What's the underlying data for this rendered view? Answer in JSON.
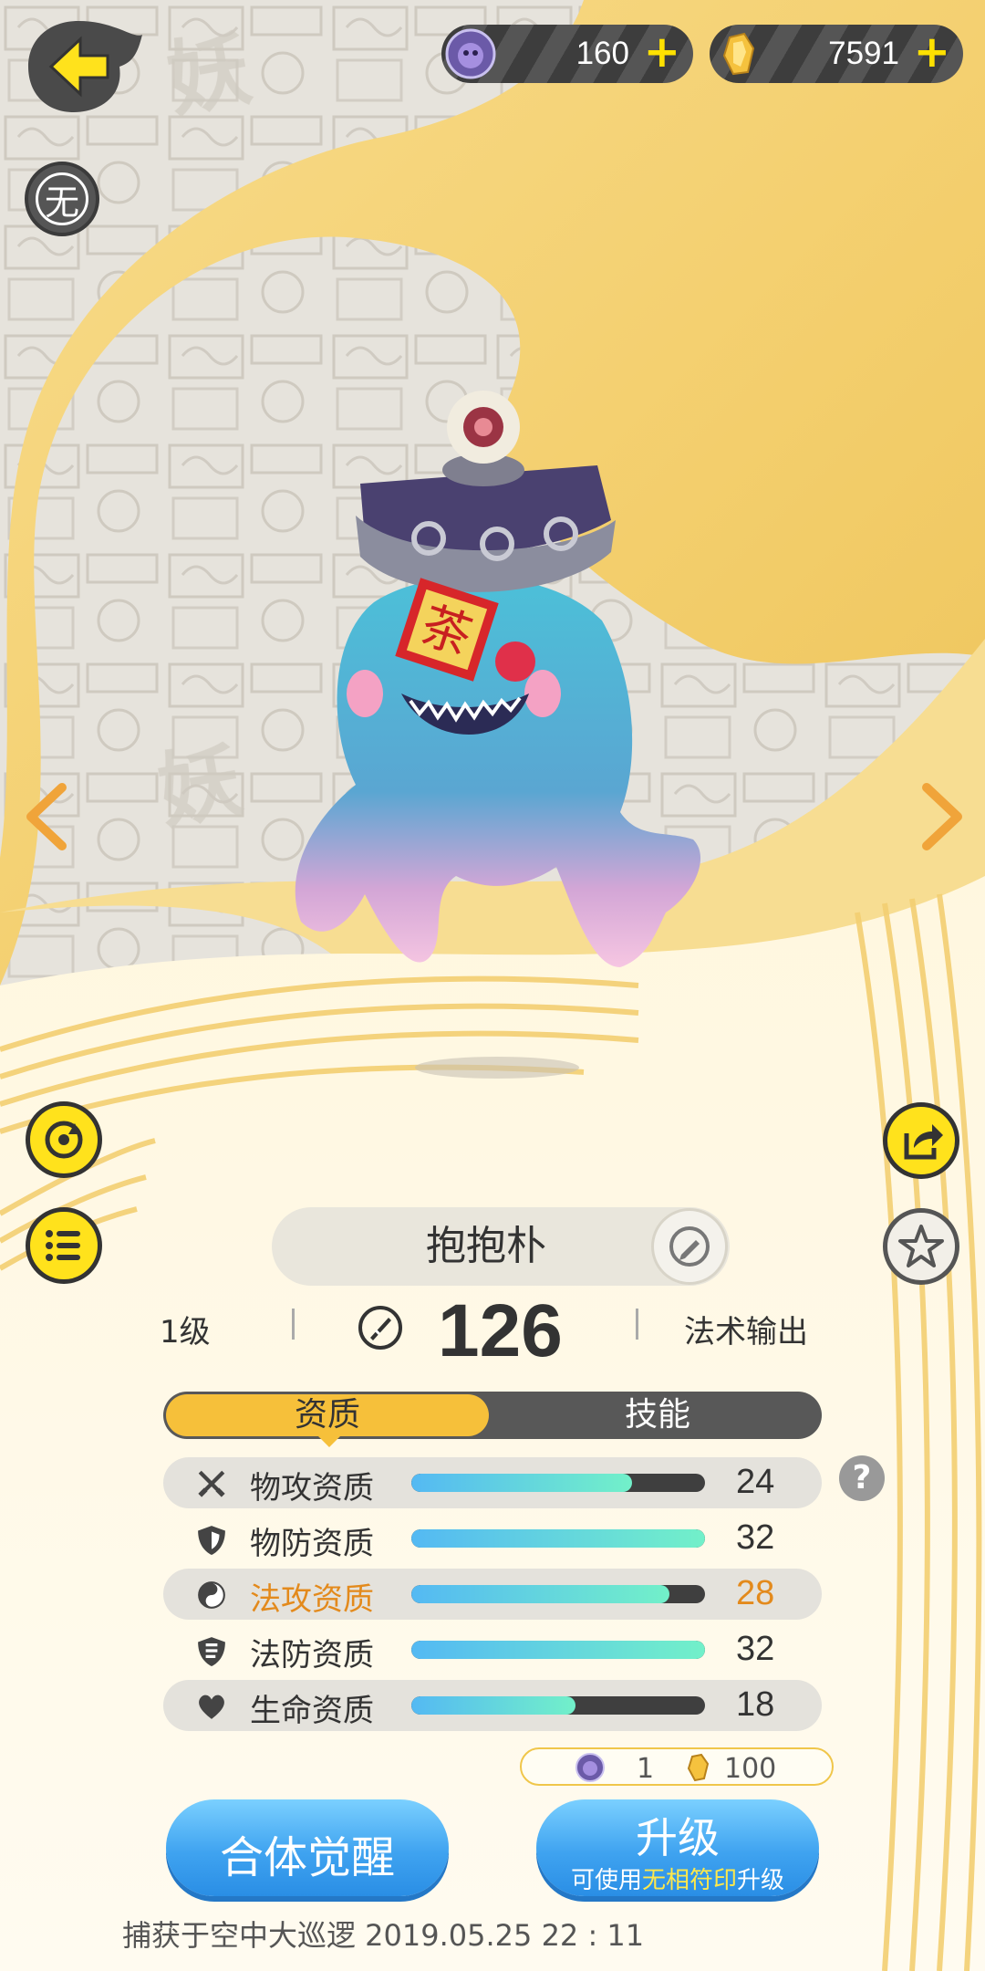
{
  "top_bar": {
    "currency_orb": {
      "value": "160",
      "plus": "+"
    },
    "currency_crystal": {
      "value": "7591",
      "plus": "+"
    }
  },
  "side_buttons": {
    "mode_badge": "无"
  },
  "pet": {
    "name": "抱抱朴",
    "level": "1级",
    "power": "126",
    "role": "法术输出",
    "hat_tag": "茶"
  },
  "tabs": [
    {
      "label": "资质",
      "active": true
    },
    {
      "label": "技能",
      "active": false
    }
  ],
  "attributes": [
    {
      "name": "物攻资质",
      "value": "24",
      "fill": 0.75,
      "icon": "crossed-swords-icon",
      "highlight": false
    },
    {
      "name": "物防资质",
      "value": "32",
      "fill": 1.0,
      "icon": "shield-icon",
      "highlight": false
    },
    {
      "name": "法攻资质",
      "value": "28",
      "fill": 0.88,
      "icon": "magic-orb-icon",
      "highlight": true
    },
    {
      "name": "法防资质",
      "value": "32",
      "fill": 1.0,
      "icon": "magic-shield-icon",
      "highlight": false
    },
    {
      "name": "生命资质",
      "value": "18",
      "fill": 0.56,
      "icon": "heart-icon",
      "highlight": false
    }
  ],
  "help": "?",
  "upgrade_cost": {
    "orb": "1",
    "crystal": "100"
  },
  "buttons": {
    "awaken": "合体觉醒",
    "upgrade": "升级",
    "upgrade_sub_pre": "可使用",
    "upgrade_sub_item": "无相符印",
    "upgrade_sub_post": "升级"
  },
  "footer": "捕获于空中大巡逻  2019.05.25   22 : 11",
  "colors": {
    "accent_yellow": "#ffe21c",
    "tab_active": "#f6c03a",
    "highlight_text": "#e38a1c",
    "button_blue": "#3fa3f0"
  }
}
